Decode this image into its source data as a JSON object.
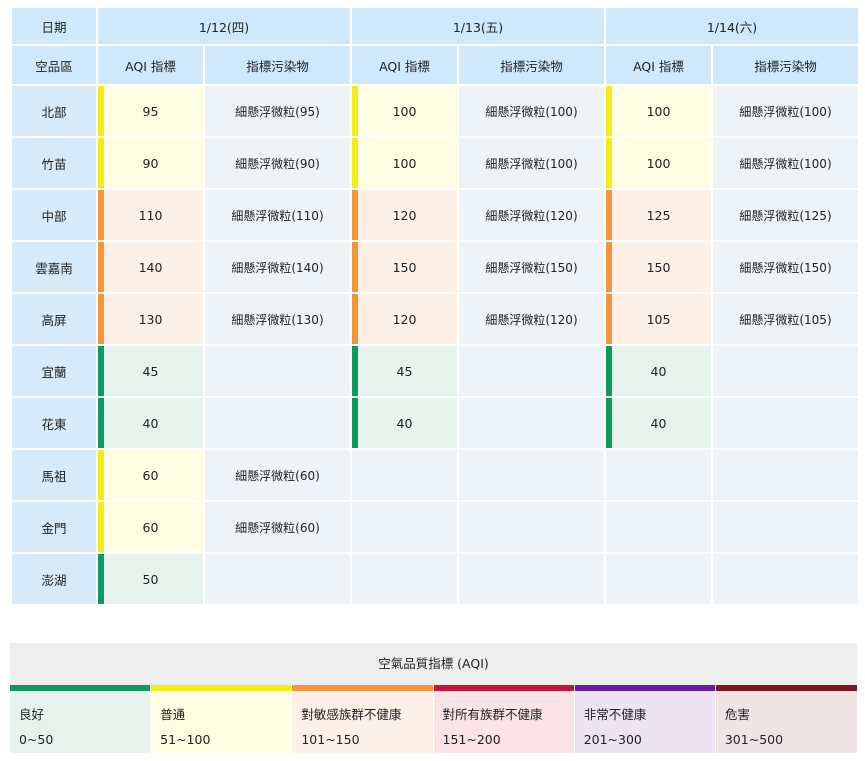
{
  "header": {
    "date_label": "日期",
    "dates": [
      "1/12(四)",
      "1/13(五)",
      "1/14(六)"
    ],
    "region_label": "空品區",
    "aqi_label": "AQI 指標",
    "pollutant_label": "指標污染物"
  },
  "rows": [
    {
      "region": "北部",
      "days": [
        {
          "aqi": "95",
          "level": "mod",
          "pollutant": "細懸浮微粒(95)"
        },
        {
          "aqi": "100",
          "level": "mod",
          "pollutant": "細懸浮微粒(100)"
        },
        {
          "aqi": "100",
          "level": "mod",
          "pollutant": "細懸浮微粒(100)"
        }
      ]
    },
    {
      "region": "竹苗",
      "days": [
        {
          "aqi": "90",
          "level": "mod",
          "pollutant": "細懸浮微粒(90)"
        },
        {
          "aqi": "100",
          "level": "mod",
          "pollutant": "細懸浮微粒(100)"
        },
        {
          "aqi": "100",
          "level": "mod",
          "pollutant": "細懸浮微粒(100)"
        }
      ]
    },
    {
      "region": "中部",
      "days": [
        {
          "aqi": "110",
          "level": "usg",
          "pollutant": "細懸浮微粒(110)"
        },
        {
          "aqi": "120",
          "level": "usg",
          "pollutant": "細懸浮微粒(120)"
        },
        {
          "aqi": "125",
          "level": "usg",
          "pollutant": "細懸浮微粒(125)"
        }
      ]
    },
    {
      "region": "雲嘉南",
      "days": [
        {
          "aqi": "140",
          "level": "usg",
          "pollutant": "細懸浮微粒(140)"
        },
        {
          "aqi": "150",
          "level": "usg",
          "pollutant": "細懸浮微粒(150)"
        },
        {
          "aqi": "150",
          "level": "usg",
          "pollutant": "細懸浮微粒(150)"
        }
      ]
    },
    {
      "region": "高屏",
      "days": [
        {
          "aqi": "130",
          "level": "usg",
          "pollutant": "細懸浮微粒(130)"
        },
        {
          "aqi": "120",
          "level": "usg",
          "pollutant": "細懸浮微粒(120)"
        },
        {
          "aqi": "105",
          "level": "usg",
          "pollutant": "細懸浮微粒(105)"
        }
      ]
    },
    {
      "region": "宜蘭",
      "days": [
        {
          "aqi": "45",
          "level": "good",
          "pollutant": ""
        },
        {
          "aqi": "45",
          "level": "good",
          "pollutant": ""
        },
        {
          "aqi": "40",
          "level": "good",
          "pollutant": ""
        }
      ]
    },
    {
      "region": "花東",
      "days": [
        {
          "aqi": "40",
          "level": "good",
          "pollutant": ""
        },
        {
          "aqi": "40",
          "level": "good",
          "pollutant": ""
        },
        {
          "aqi": "40",
          "level": "good",
          "pollutant": ""
        }
      ]
    },
    {
      "region": "馬祖",
      "days": [
        {
          "aqi": "60",
          "level": "mod",
          "pollutant": "細懸浮微粒(60)"
        },
        {
          "aqi": "",
          "level": "",
          "pollutant": ""
        },
        {
          "aqi": "",
          "level": "",
          "pollutant": ""
        }
      ]
    },
    {
      "region": "金門",
      "days": [
        {
          "aqi": "60",
          "level": "mod",
          "pollutant": "細懸浮微粒(60)"
        },
        {
          "aqi": "",
          "level": "",
          "pollutant": ""
        },
        {
          "aqi": "",
          "level": "",
          "pollutant": ""
        }
      ]
    },
    {
      "region": "澎湖",
      "days": [
        {
          "aqi": "50",
          "level": "good",
          "pollutant": ""
        },
        {
          "aqi": "",
          "level": "",
          "pollutant": ""
        },
        {
          "aqi": "",
          "level": "",
          "pollutant": ""
        }
      ]
    }
  ],
  "legend": {
    "title": "空氣品質指標 (AQI)",
    "items": [
      {
        "label": "良好",
        "range": "0~50",
        "color": "#0e9a5e",
        "bg": "#e6f3ec"
      },
      {
        "label": "普通",
        "range": "51~100",
        "color": "#f5ec17",
        "bg": "#fffde4"
      },
      {
        "label": "對敏感族群不健康",
        "range": "101~150",
        "color": "#f5953a",
        "bg": "#fdf0e6"
      },
      {
        "label": "對所有族群不健康",
        "range": "151~200",
        "color": "#c8143c",
        "bg": "#fbe3e8"
      },
      {
        "label": "非常不健康",
        "range": "201~300",
        "color": "#6a1b9a",
        "bg": "#ece3f3"
      },
      {
        "label": "危害",
        "range": "301~500",
        "color": "#7e1426",
        "bg": "#f0e4e6"
      }
    ]
  }
}
